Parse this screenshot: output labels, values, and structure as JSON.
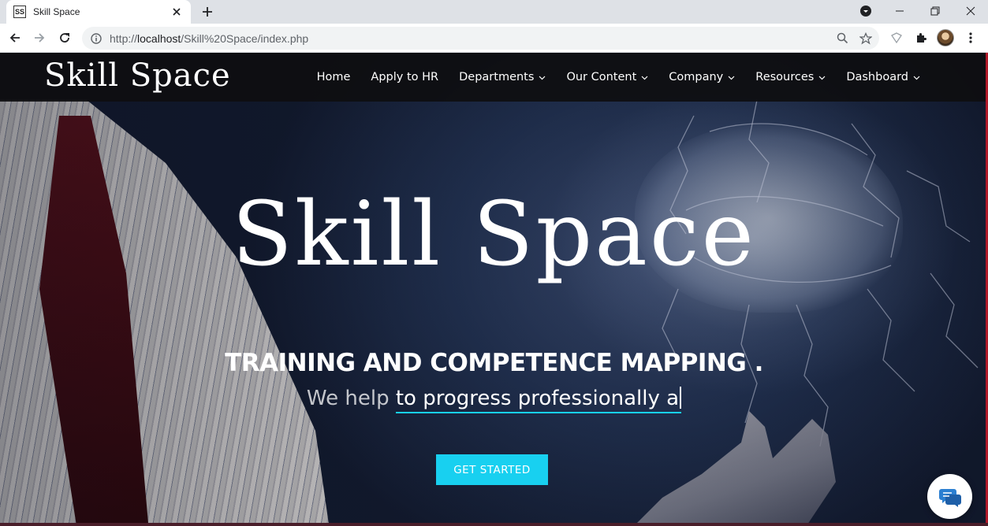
{
  "browser": {
    "tab": {
      "favicon": "SS",
      "title": "Skill Space"
    },
    "url": {
      "prefix": "http://",
      "host": "localhost",
      "path": "/Skill%20Space/index.php"
    }
  },
  "nav": {
    "logo": "Skill Space",
    "items": [
      {
        "label": "Home",
        "dropdown": false
      },
      {
        "label": "Apply to HR",
        "dropdown": false
      },
      {
        "label": "Departments",
        "dropdown": true
      },
      {
        "label": "Our Content",
        "dropdown": true
      },
      {
        "label": "Company",
        "dropdown": true
      },
      {
        "label": "Resources",
        "dropdown": true
      },
      {
        "label": "Dashboard",
        "dropdown": true
      }
    ]
  },
  "hero": {
    "title": "Skill Space",
    "tagline": "TRAINING AND COMPETENCE MAPPING .",
    "subline_static": "We help ",
    "subline_typed": "to progress professionally a",
    "cta": "GET STARTED"
  },
  "colors": {
    "accent": "#18d0f0",
    "navbar": "#0e0e10"
  },
  "icons": {
    "chat": "chat-bubble-icon"
  }
}
